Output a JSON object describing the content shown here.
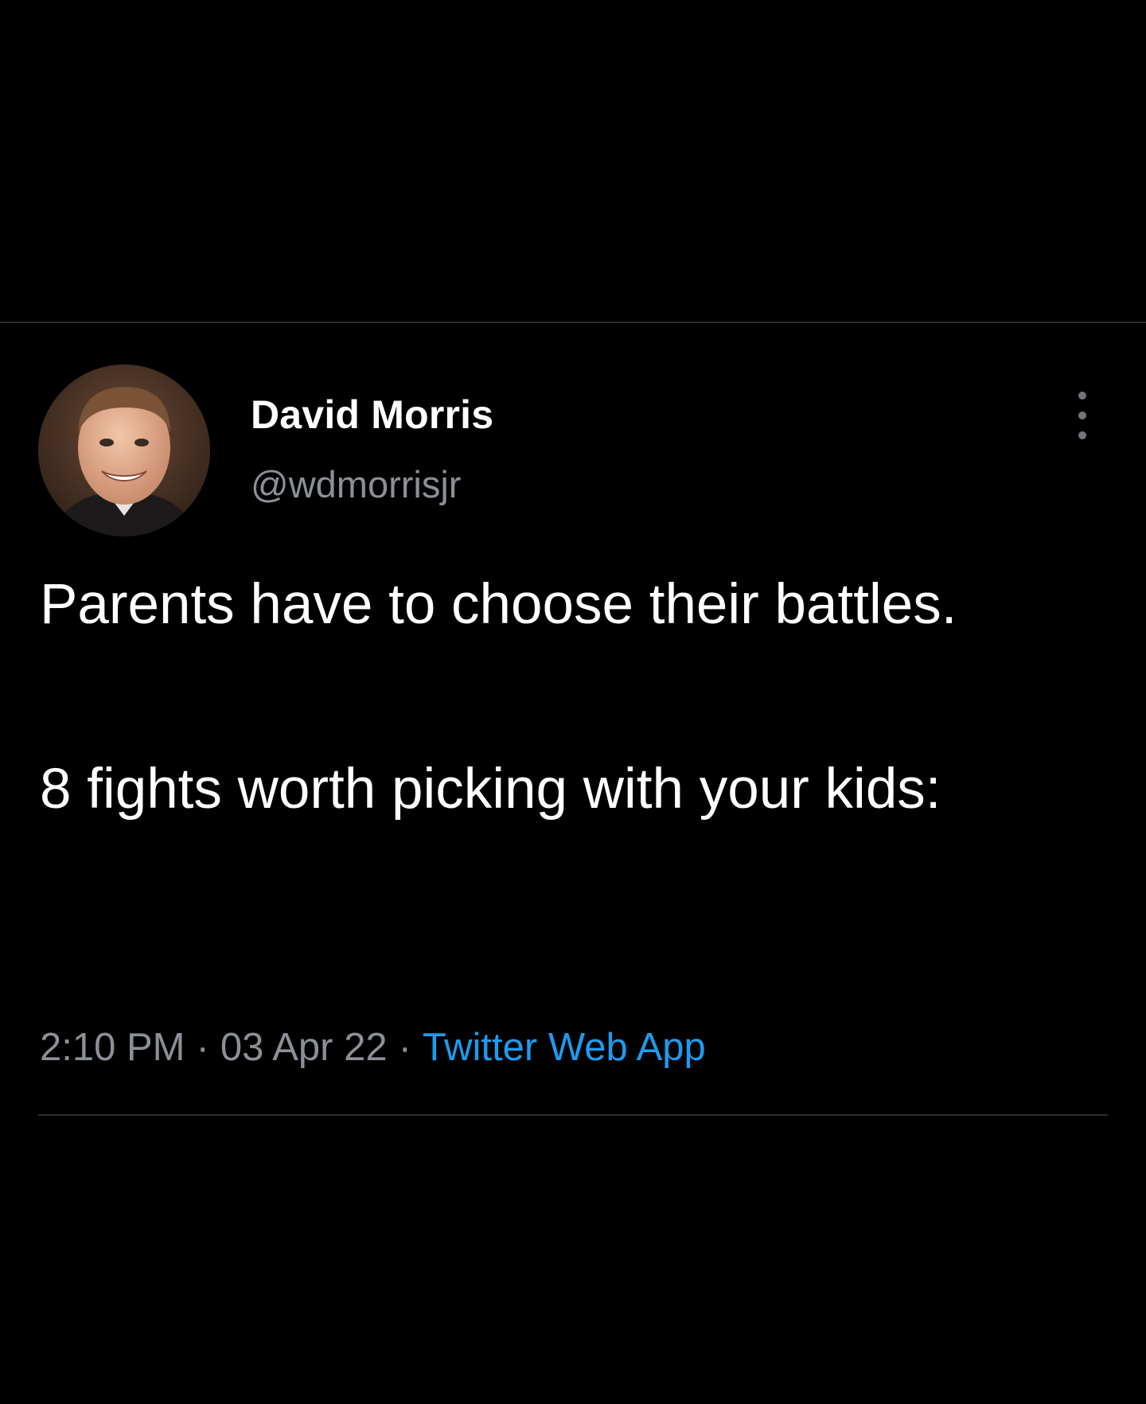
{
  "tweet": {
    "author": {
      "display_name": "David Morris",
      "handle": "@wdmorrisjr",
      "avatar_icon": "profile-photo"
    },
    "text_paragraph_1": "Parents have to choose their battles.",
    "text_paragraph_2": "8 fights worth picking with your kids:",
    "meta": {
      "time": "2:10 PM",
      "separator": "·",
      "date": "03 Apr 22",
      "source": "Twitter Web App"
    },
    "more_icon": "more-vertical-icon"
  },
  "colors": {
    "background": "#000000",
    "primary_text": "#ffffff",
    "secondary_text": "#8b9096",
    "link": "#1d9bf0",
    "divider": "#2a2d30"
  }
}
